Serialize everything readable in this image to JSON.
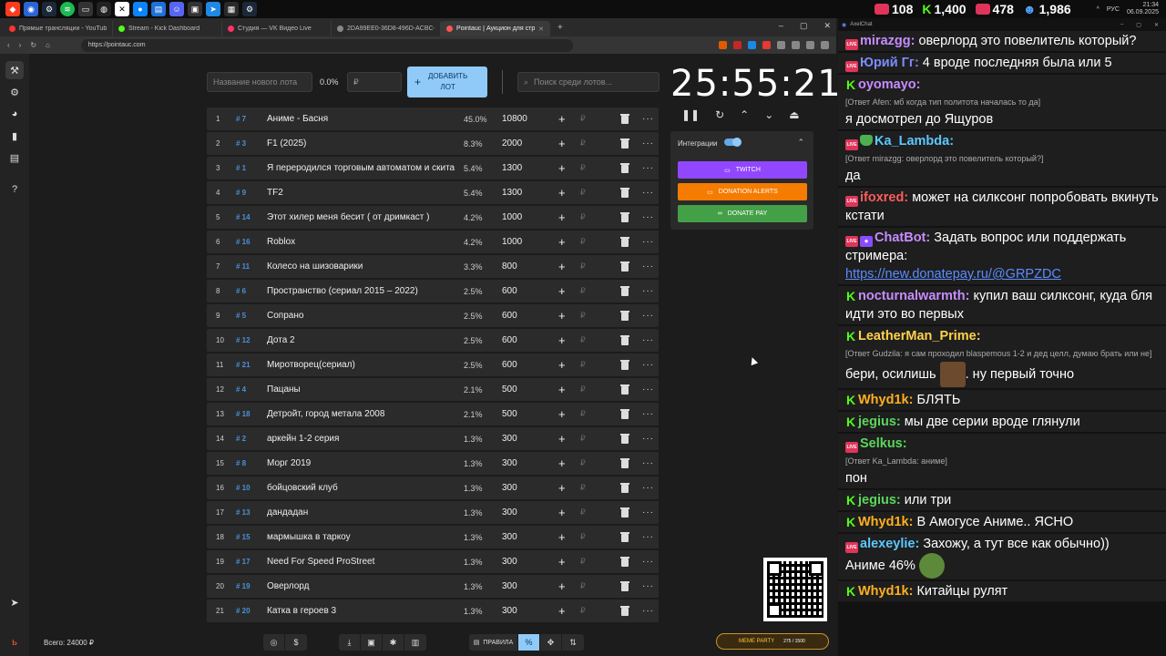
{
  "taskbar": {
    "stats": [
      {
        "value": "108",
        "color": "#e0345a"
      },
      {
        "value": "1,400",
        "color": "#53fc18"
      },
      {
        "value": "478",
        "color": "#e0345a"
      },
      {
        "value": "1,986",
        "color": "#4fa3ff"
      }
    ],
    "lang": "РУС",
    "time": "21:34",
    "date": "06.09.2025"
  },
  "browser": {
    "tabs": [
      {
        "label": "Прямые трансляции - YouTube Studio",
        "color": "#ff3333"
      },
      {
        "label": "Stream - Kick Dashboard",
        "color": "#53fc18"
      },
      {
        "label": "Студия — VK Видео Live",
        "color": "#ff3366"
      },
      {
        "label": "2DA99EE0-36D8-496D-ACBC-C463...",
        "color": "#888888"
      },
      {
        "label": "Pointauc | Аукцион для стримеров",
        "color": "#ff5555"
      }
    ],
    "url": "https://pointauc.com"
  },
  "controls": {
    "lot_placeholder": "Название нового лота",
    "percent": "0.0%",
    "amount_placeholder": "₽",
    "add_line1": "ДОБАВИТЬ",
    "add_line2": "ЛОТ",
    "search_placeholder": "Поиск среди лотов..."
  },
  "lots": [
    {
      "idx": "1",
      "id": "# 7",
      "name": "Аниме - Басня",
      "pct": "45.0%",
      "amount": "10800"
    },
    {
      "idx": "2",
      "id": "# 3",
      "name": "F1 (2025)",
      "pct": "8.3%",
      "amount": "2000"
    },
    {
      "idx": "3",
      "id": "# 1",
      "name": "Я переродился торговым автоматом и скитаюсь по подземелью",
      "pct": "5.4%",
      "amount": "1300"
    },
    {
      "idx": "4",
      "id": "# 9",
      "name": "TF2",
      "pct": "5.4%",
      "amount": "1300"
    },
    {
      "idx": "5",
      "id": "# 14",
      "name": "Этот хилер меня бесит ( от дримкаст )",
      "pct": "4.2%",
      "amount": "1000"
    },
    {
      "idx": "6",
      "id": "# 16",
      "name": "Roblox",
      "pct": "4.2%",
      "amount": "1000"
    },
    {
      "idx": "7",
      "id": "# 11",
      "name": " Колесо на шизоварики",
      "pct": "3.3%",
      "amount": "800"
    },
    {
      "idx": "8",
      "id": "# 6",
      "name": "Пространство (сериал 2015 – 2022)",
      "pct": "2.5%",
      "amount": "600"
    },
    {
      "idx": "9",
      "id": "# 5",
      "name": "Сопрано",
      "pct": "2.5%",
      "amount": "600"
    },
    {
      "idx": "10",
      "id": "# 12",
      "name": "Дота 2",
      "pct": "2.5%",
      "amount": "600"
    },
    {
      "idx": "11",
      "id": "# 21",
      "name": "Миротворец(сериал)",
      "pct": "2.5%",
      "amount": "600"
    },
    {
      "idx": "12",
      "id": "# 4",
      "name": "Пацаны",
      "pct": "2.1%",
      "amount": "500"
    },
    {
      "idx": "13",
      "id": "# 18",
      "name": "Детройт, город метала 2008",
      "pct": "2.1%",
      "amount": "500"
    },
    {
      "idx": "14",
      "id": "# 2",
      "name": "аркейн 1-2 серия",
      "pct": "1.3%",
      "amount": "300"
    },
    {
      "idx": "15",
      "id": "# 8",
      "name": "Морг 2019",
      "pct": "1.3%",
      "amount": "300"
    },
    {
      "idx": "16",
      "id": "# 10",
      "name": "бойцовский клуб",
      "pct": "1.3%",
      "amount": "300"
    },
    {
      "idx": "17",
      "id": "# 13",
      "name": "дандадан",
      "pct": "1.3%",
      "amount": "300"
    },
    {
      "idx": "18",
      "id": "# 15",
      "name": "мармышка в таркоу",
      "pct": "1.3%",
      "amount": "300"
    },
    {
      "idx": "19",
      "id": "# 17",
      "name": "Need For Speed ProStreet",
      "pct": "1.3%",
      "amount": "300"
    },
    {
      "idx": "20",
      "id": "# 19",
      "name": "Оверлорд",
      "pct": "1.3%",
      "amount": "300"
    },
    {
      "idx": "21",
      "id": "# 20",
      "name": "Катка в героев 3",
      "pct": "1.3%",
      "amount": "300"
    }
  ],
  "row_icons": {
    "plus": "+",
    "rub": "₽",
    "more": "···"
  },
  "timer": "25:55:21",
  "integrations": {
    "title": "Интеграции",
    "buttons": [
      {
        "label": "TWITCH",
        "color": "#9147ff"
      },
      {
        "label": "DONATION ALERTS",
        "color": "#f57c00"
      },
      {
        "label": "DONATE PAY",
        "color": "#43a047"
      }
    ]
  },
  "meme": {
    "label": "MEME PARTY",
    "progress": "275 / 1500"
  },
  "footer": {
    "total": "Всего: 24000 ₽",
    "rules": "ПРАВИЛА",
    "percent_icon": "%"
  },
  "chat": {
    "title": "AxelChat",
    "messages": [
      {
        "badges": [
          "live"
        ],
        "nick": "mirazgg",
        "color": "#c78cff",
        "text": "оверлорд это повелитель который?"
      },
      {
        "badges": [
          "live"
        ],
        "nick": "Юрий Гг",
        "color": "#7b8cff",
        "text": "4 вроде последняя была или 5"
      },
      {
        "badges": [
          "k"
        ],
        "nick": "oyomayo",
        "color": "#c78cff",
        "reply": "[Ответ Afen: мб когда тип политота началась то да]",
        "text": "я досмотрел до Ящуров"
      },
      {
        "badges": [
          "live",
          "sh"
        ],
        "nick": "Ka_Lambda",
        "color": "#5bc8ff",
        "reply": "[Ответ mirazgg: оверлорд это повелитель который?]",
        "text": "да"
      },
      {
        "badges": [
          "live"
        ],
        "nick": "ifoxred",
        "color": "#ff5c5c",
        "text": "может на силксонг попробовать вкинуть кстати"
      },
      {
        "badges": [
          "live",
          "bot"
        ],
        "nick": "ChatBot",
        "color": "#c78cff",
        "text": "Задать вопрос или поддержать стримера:",
        "link": "https://new.donatepay.ru/@GRPZDC"
      },
      {
        "badges": [
          "k"
        ],
        "nick": "nocturnalwarmth",
        "color": "#c78cff",
        "text": "купил ваш силксонг, куда бля идти это во первых"
      },
      {
        "badges": [
          "k"
        ],
        "nick": "LeatherMan_Prime",
        "color": "#ffd24a",
        "reply": "[Ответ Gudzila: я сам проходил blaspemous 1-2 и дед целл, думаю брать или не]",
        "text_before": "бери, осилишь",
        "text_after": ". ну первый точно"
      },
      {
        "badges": [
          "k"
        ],
        "nick": "Whyd1k",
        "color": "#ffb020",
        "text": "БЛЯТЬ"
      },
      {
        "badges": [
          "k"
        ],
        "nick": "jegius",
        "color": "#5bd65b",
        "text": "мы две серии вроде глянули"
      },
      {
        "badges": [
          "live"
        ],
        "nick": "Selkus",
        "color": "#5bd65b",
        "reply": "[Ответ Ka_Lambda: аниме]",
        "text": "пон"
      },
      {
        "badges": [
          "k"
        ],
        "nick": "jegius",
        "color": "#5bd65b",
        "text": "или три"
      },
      {
        "badges": [
          "k"
        ],
        "nick": "Whyd1k",
        "color": "#ffb020",
        "text": "В Амогусе Аниме.. ЯСНО"
      },
      {
        "badges": [
          "live"
        ],
        "nick": "alexeylie",
        "color": "#5bc8ff",
        "text": "Захожу, а тут все как обычно))",
        "text2": "Аниме 46%"
      },
      {
        "badges": [
          "k"
        ],
        "nick": "Whyd1k",
        "color": "#ffb020",
        "text": "Китайцы рулят"
      }
    ]
  }
}
